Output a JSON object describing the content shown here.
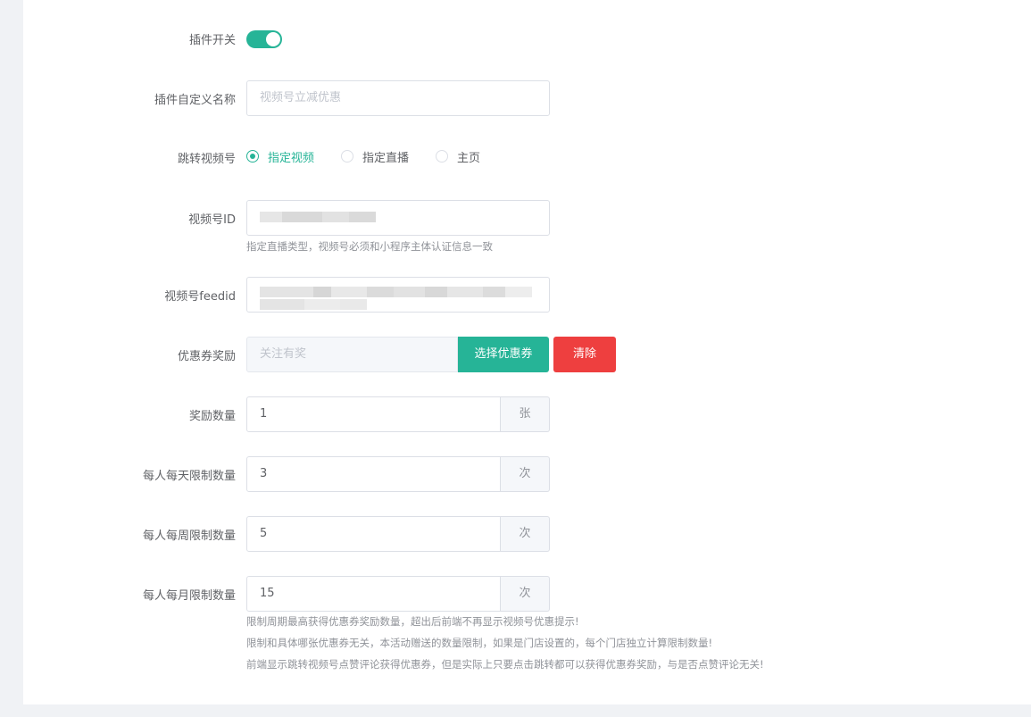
{
  "form": {
    "plugin_switch": {
      "label": "插件开关",
      "on": true
    },
    "custom_name": {
      "label": "插件自定义名称",
      "placeholder": "视频号立减优惠"
    },
    "jump_target": {
      "label": "跳转视频号",
      "options": [
        "指定视频",
        "指定直播",
        "主页"
      ],
      "selected": "指定视频"
    },
    "channel_id": {
      "label": "视频号ID",
      "help": "指定直播类型，视频号必须和小程序主体认证信息一致"
    },
    "feed_id": {
      "label": "视频号feedid"
    },
    "coupon_reward": {
      "label": "优惠券奖励",
      "placeholder": "关注有奖",
      "select_button": "选择优惠券",
      "clear_button": "清除"
    },
    "reward_qty": {
      "label": "奖励数量",
      "value": "1",
      "unit": "张"
    },
    "daily_limit": {
      "label": "每人每天限制数量",
      "value": "3",
      "unit": "次"
    },
    "weekly_limit": {
      "label": "每人每周限制数量",
      "value": "5",
      "unit": "次"
    },
    "monthly_limit": {
      "label": "每人每月限制数量",
      "value": "15",
      "unit": "次",
      "help": [
        "限制周期最高获得优惠券奖励数量，超出后前端不再显示视频号优惠提示!",
        "限制和具体哪张优惠券无关，本活动赠送的数量限制，如果是门店设置的，每个门店独立计算限制数量!",
        "前端显示跳转视频号点赞评论获得优惠券，但是实际上只要点击跳转都可以获得优惠券奖励，与是否点赞评论无关!"
      ]
    }
  },
  "colors": {
    "accent": "#26b497",
    "danger": "#ee3f3f"
  }
}
